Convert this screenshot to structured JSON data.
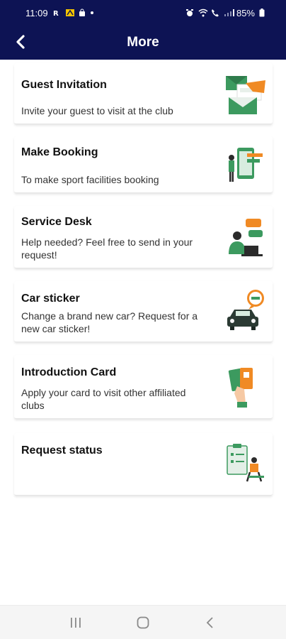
{
  "status_bar": {
    "time": "11:09",
    "battery": "85%"
  },
  "header": {
    "title": "More"
  },
  "items": [
    {
      "title": "Guest Invitation",
      "description": "Invite your guest to visit at the club",
      "icon": "guest-invitation-envelope-icon"
    },
    {
      "title": "Make Booking",
      "description": "To make sport facilities booking",
      "icon": "booking-phone-icon"
    },
    {
      "title": "Service Desk",
      "description": "Help needed? Feel free to send in your request!",
      "icon": "service-desk-chat-icon"
    },
    {
      "title": "Car sticker",
      "description": "Change a brand new car? Request for a new car sticker!",
      "icon": "car-sticker-icon"
    },
    {
      "title": "Introduction Card",
      "description": "Apply your card to visit other affiliated clubs",
      "icon": "introduction-card-icon"
    },
    {
      "title": "Request status",
      "description": "",
      "icon": "request-status-clipboard-icon"
    }
  ],
  "colors": {
    "header_bg": "#0d1354",
    "accent_green": "#3c9a5f",
    "accent_orange": "#f08a24"
  }
}
